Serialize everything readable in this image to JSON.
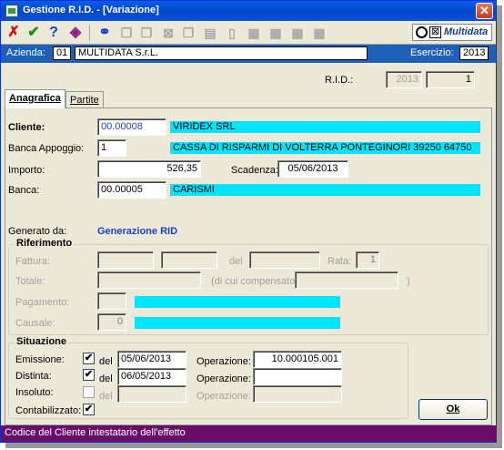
{
  "window": {
    "title": "Gestione R.I.D. - [Variazione]",
    "close_glyph": "✕"
  },
  "toolbar": {
    "buttons": [
      {
        "icon": "cancel-x-icon",
        "glyph": "✗"
      },
      {
        "icon": "confirm-check-icon",
        "glyph": "✔"
      },
      {
        "icon": "help-question-icon",
        "glyph": "?"
      },
      {
        "icon": "tag-icon",
        "glyph": "◈"
      },
      {
        "icon": "binoculars-icon",
        "glyph": "⚭"
      },
      {
        "icon": "copy-icon",
        "glyph": "❐"
      },
      {
        "icon": "paste-icon",
        "glyph": "❐"
      },
      {
        "icon": "delete-icon",
        "glyph": "⊠"
      },
      {
        "icon": "duplicate-icon",
        "glyph": "❐"
      },
      {
        "icon": "document-icon",
        "glyph": "▤"
      },
      {
        "icon": "new-document-icon",
        "glyph": "▯"
      },
      {
        "icon": "table-icon",
        "glyph": "▦"
      },
      {
        "icon": "table-edit-icon",
        "glyph": "▦"
      },
      {
        "icon": "grid-icon",
        "glyph": "▦"
      },
      {
        "icon": "list-icon",
        "glyph": "▦"
      }
    ],
    "brand": "Multidata",
    "brand_x": "⊠"
  },
  "header": {
    "azienda_label": "Azienda:",
    "azienda_code": "01",
    "azienda_name": "MULTIDATA S.r.L.",
    "esercizio_label": "Esercizio:",
    "esercizio_value": "2013"
  },
  "rid": {
    "label": "R.I.D.:",
    "year": "2013",
    "number": "1"
  },
  "tabs": [
    {
      "label": "Anagrafica",
      "active": true
    },
    {
      "label": "Partite",
      "active": false
    }
  ],
  "form": {
    "cliente_label": "Cliente:",
    "cliente_code": "00.00008",
    "cliente_name": "VIRIDEX SRL",
    "banca_appoggio_label": "Banca Appoggio:",
    "banca_appoggio_code": "1",
    "banca_appoggio_desc": "CASSA DI RISPARMI DI VOLTERRA PONTEGINORI 39250 64750",
    "importo_label": "Importo:",
    "importo_value": "526,35",
    "scadenza_label": "Scadenza:",
    "scadenza_value": "05/06/2013",
    "banca_label": "Banca:",
    "banca_code": "00.00005",
    "banca_name": "CARISMI",
    "generato_label": "Generato da:",
    "generato_value": "Generazione RID"
  },
  "riferimento": {
    "title": "Riferimento",
    "fattura_label": "Fattura:",
    "del_label": "del",
    "rata_label": "Rata:",
    "rata_value": "1",
    "totale_label": "Totale:",
    "compensato_label": "(di cui compensato:",
    "compensato_close": ")",
    "pagamento_label": "Pagamento:",
    "causale_label": "Causale:",
    "causale_value": "0"
  },
  "situazione": {
    "title": "Situazione",
    "rows": [
      {
        "label": "Emissione:",
        "checked": true,
        "del": "del",
        "date": "05/06/2013",
        "op_label": "Operazione:",
        "op_value": "10.000105.001",
        "enabled": true
      },
      {
        "label": "Distinta:",
        "checked": true,
        "del": "del",
        "date": "06/05/2013",
        "op_label": "Operazione:",
        "op_value": "",
        "enabled": true
      },
      {
        "label": "Insoluto:",
        "checked": false,
        "del": "del",
        "date": "",
        "op_label": "Operazione:",
        "op_value": "",
        "enabled": false
      }
    ],
    "contabilizzato_label": "Contabilizzato:",
    "contabilizzato_checked": true,
    "check_glyph": "✔"
  },
  "ok_button": {
    "label": "Ok"
  },
  "statusbar": {
    "text": "Codice del Cliente intestatario dell'effetto"
  },
  "colors": {
    "accent": "#1e5fb8",
    "cyan": "#00e5ff",
    "status": "#6a0d6a"
  }
}
